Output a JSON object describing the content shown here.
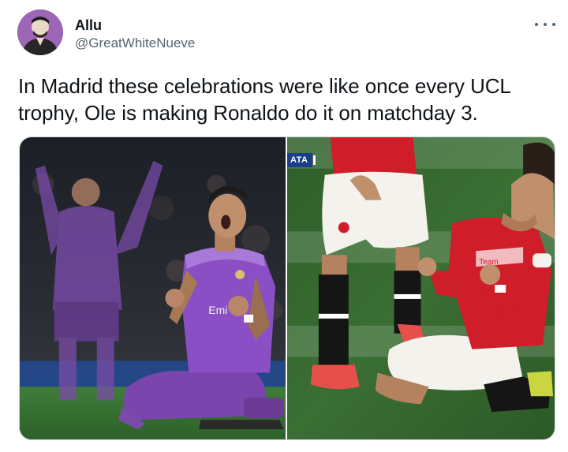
{
  "author": {
    "display_name": "Allu",
    "handle": "@GreatWhiteNueve",
    "avatar_icon": "user-avatar"
  },
  "menu": {
    "icon": "more-options-icon"
  },
  "tweet": {
    "text": "In Madrid these celebrations were like once every UCL trophy, Ole is making Ronaldo do it on matchday 3."
  },
  "media": {
    "left_photo": {
      "description_icon": "photo-icon"
    },
    "right_photo": {
      "scoreboard_badge": "ATA"
    }
  },
  "colors": {
    "text_primary": "#0f1419",
    "text_secondary": "#536471",
    "border": "#cfd9de",
    "real_madrid_purple": "#7a3fb0",
    "man_utd_red": "#d01d2a"
  }
}
